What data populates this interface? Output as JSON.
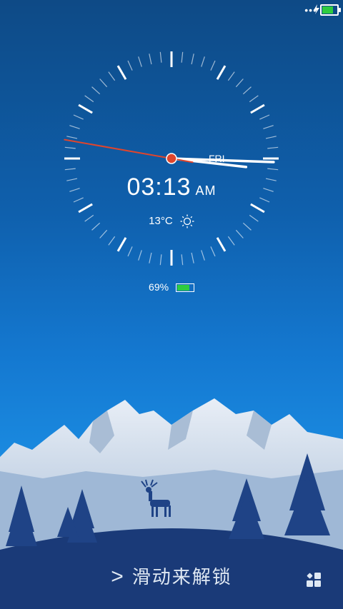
{
  "status": {
    "dots_icon": "more-dots-icon",
    "charging_icon": "lightning-icon",
    "battery_icon": "battery-icon"
  },
  "clock": {
    "time": "03:13",
    "ampm": "AM",
    "day": "FRI"
  },
  "weather": {
    "temp": "13°C",
    "icon": "sun-icon"
  },
  "battery": {
    "percent": "69%"
  },
  "lock": {
    "unlock_text": "滑动来解锁",
    "chevron": ">"
  },
  "icons": {
    "apps": "apps-grid-icon"
  },
  "colors": {
    "accent_red": "#e0452c",
    "battery_green": "#2ecc40"
  }
}
